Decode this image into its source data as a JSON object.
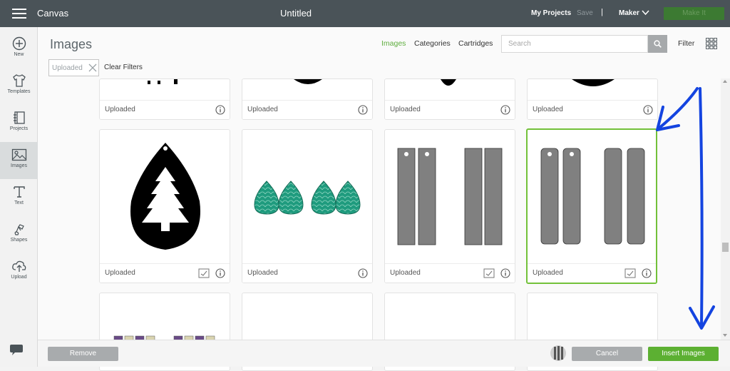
{
  "topbar": {
    "app_name": "Canvas",
    "doc_title": "Untitled",
    "my_projects": "My Projects",
    "save": "Save",
    "separator": "|",
    "machine": "Maker",
    "make_it": "Make It"
  },
  "sidebar": {
    "items": [
      {
        "label": "New",
        "icon": "plus-circle-icon"
      },
      {
        "label": "Templates",
        "icon": "shirt-icon"
      },
      {
        "label": "Projects",
        "icon": "notebook-icon"
      },
      {
        "label": "Images",
        "icon": "image-icon"
      },
      {
        "label": "Text",
        "icon": "text-icon"
      },
      {
        "label": "Shapes",
        "icon": "shapes-icon"
      },
      {
        "label": "Upload",
        "icon": "cloud-upload-icon"
      }
    ],
    "active": "Images"
  },
  "panel": {
    "title": "Images",
    "tabs": [
      "Images",
      "Categories",
      "Cartridges"
    ],
    "active_tab": "Images",
    "search_placeholder": "Search",
    "filter_label": "Filter",
    "chip_label": "Uploaded",
    "clear_filters": "Clear Filters"
  },
  "cards": {
    "label": "Uploaded",
    "top_row": [
      "Uploaded",
      "Uploaded",
      "Uploaded",
      "Uploaded"
    ],
    "middle_row": [
      {
        "label": "Uploaded",
        "image": "teardrop-tree-earring",
        "selected": false
      },
      {
        "label": "Uploaded",
        "image": "teal-scale-teardrop-earrings",
        "selected": false
      },
      {
        "label": "Uploaded",
        "image": "gray-bar-earrings-square",
        "selected": false
      },
      {
        "label": "Uploaded",
        "image": "gray-bar-earrings-rounded",
        "selected": true
      }
    ]
  },
  "bottombar": {
    "remove": "Remove",
    "cancel": "Cancel",
    "insert": "Insert Images"
  },
  "colors": {
    "topbar": "#4a5358",
    "accent_green": "#5cb032",
    "selection_green": "#73c13a",
    "teal": "#1f9b7e",
    "annotation_blue": "#1444e0"
  }
}
